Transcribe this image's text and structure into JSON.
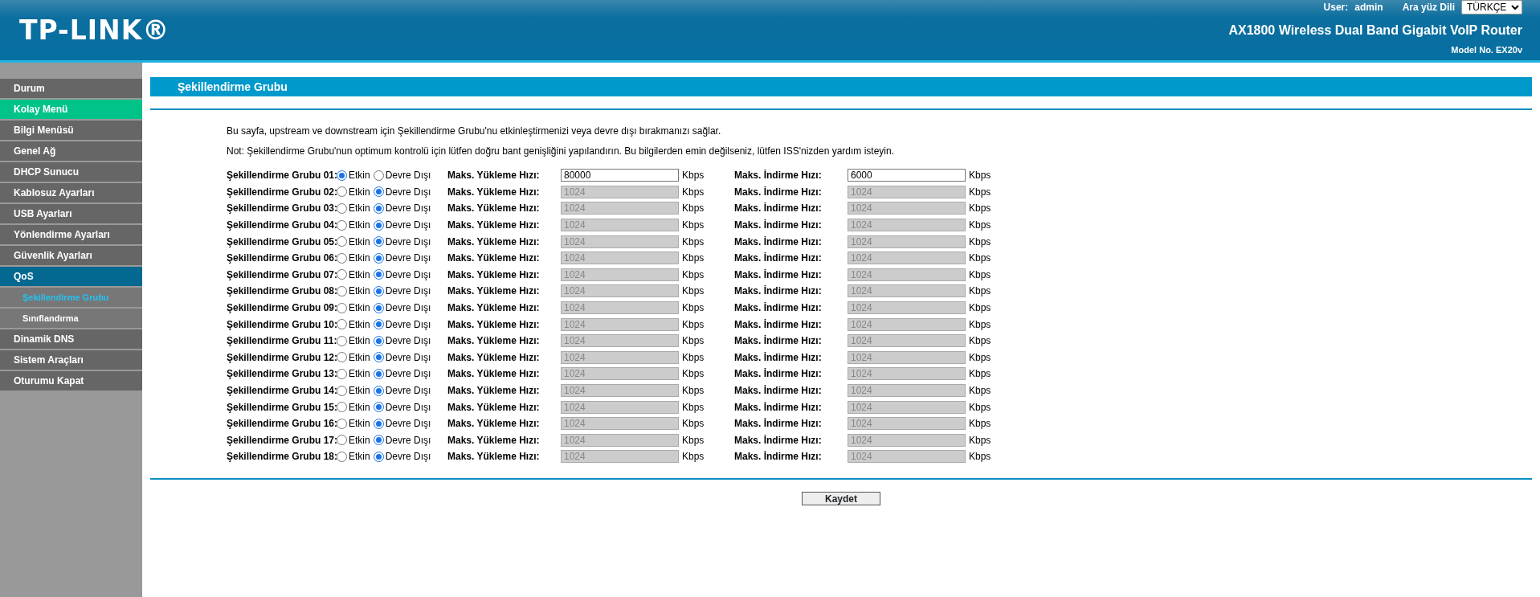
{
  "header": {
    "logo": "TP-LINK®",
    "user_label": "User:",
    "user": "admin",
    "language_label": "Ara yüz Dili",
    "language": "TÜRKÇE",
    "product": "AX1800 Wireless Dual Band Gigabit VoIP Router",
    "model": "Model No. EX20v"
  },
  "sidebar": {
    "items": [
      {
        "label": "Durum",
        "selected": false,
        "highlight": false
      },
      {
        "label": "Kolay Menü",
        "selected": false,
        "highlight": true
      },
      {
        "label": "Bilgi Menüsü",
        "selected": false,
        "highlight": false
      },
      {
        "label": "Genel Ağ",
        "selected": false,
        "highlight": false
      },
      {
        "label": "DHCP Sunucu",
        "selected": false,
        "highlight": false
      },
      {
        "label": "Kablosuz Ayarları",
        "selected": false,
        "highlight": false
      },
      {
        "label": "USB Ayarları",
        "selected": false,
        "highlight": false
      },
      {
        "label": "Yönlendirme Ayarları",
        "selected": false,
        "highlight": false
      },
      {
        "label": "Güvenlik Ayarları",
        "selected": false,
        "highlight": false
      },
      {
        "label": "QoS",
        "selected": true,
        "highlight": false,
        "children": [
          {
            "label": "Şekillendirme Grubu",
            "selected": true
          },
          {
            "label": "Sınıflandırma",
            "selected": false
          }
        ]
      },
      {
        "label": "Dinamik DNS",
        "selected": false,
        "highlight": false
      },
      {
        "label": "Sistem Araçları",
        "selected": false,
        "highlight": false
      },
      {
        "label": "Oturumu Kapat",
        "selected": false,
        "highlight": false
      }
    ]
  },
  "page": {
    "title": "Şekillendirme Grubu",
    "description": "Bu sayfa, upstream ve downstream için Şekillendirme Grubu'nu etkinleştirmenizi veya devre dışı bırakmanızı sağlar.",
    "note": "Not: Şekillendirme Grubu'nun optimum kontrolü için lütfen doğru bant genişliğini yapılandırın. Bu bilgilerden emin değilseniz, lütfen ISS'nizden yardım isteyin.",
    "rows": [
      {
        "label": "Şekillendirme Grubu 01:",
        "options": [
          {
            "label": "Etkin",
            "selected": true
          },
          {
            "label": "Devre Dışı",
            "selected": false
          }
        ],
        "upload": {
          "label": "Maks. Yükleme Hızı:",
          "value": "80000",
          "unit": "Kbps",
          "disabled": false
        },
        "download": {
          "label": "Maks. İndirme Hızı:",
          "value": "6000",
          "unit": "Kbps",
          "disabled": false
        }
      },
      {
        "label": "Şekillendirme Grubu 02:",
        "options": [
          {
            "label": "Etkin",
            "selected": false
          },
          {
            "label": "Devre Dışı",
            "selected": true
          }
        ],
        "upload": {
          "label": "Maks. Yükleme Hızı:",
          "value": "1024",
          "unit": "Kbps",
          "disabled": true
        },
        "download": {
          "label": "Maks. İndirme Hızı:",
          "value": "1024",
          "unit": "Kbps",
          "disabled": true
        }
      },
      {
        "label": "Şekillendirme Grubu 03:",
        "options": [
          {
            "label": "Etkin",
            "selected": false
          },
          {
            "label": "Devre Dışı",
            "selected": true
          }
        ],
        "upload": {
          "label": "Maks. Yükleme Hızı:",
          "value": "1024",
          "unit": "Kbps",
          "disabled": true
        },
        "download": {
          "label": "Maks. İndirme Hızı:",
          "value": "1024",
          "unit": "Kbps",
          "disabled": true
        }
      },
      {
        "label": "Şekillendirme Grubu 04:",
        "options": [
          {
            "label": "Etkin",
            "selected": false
          },
          {
            "label": "Devre Dışı",
            "selected": true
          }
        ],
        "upload": {
          "label": "Maks. Yükleme Hızı:",
          "value": "1024",
          "unit": "Kbps",
          "disabled": true
        },
        "download": {
          "label": "Maks. İndirme Hızı:",
          "value": "1024",
          "unit": "Kbps",
          "disabled": true
        }
      },
      {
        "label": "Şekillendirme Grubu 05:",
        "options": [
          {
            "label": "Etkin",
            "selected": false
          },
          {
            "label": "Devre Dışı",
            "selected": true
          }
        ],
        "upload": {
          "label": "Maks. Yükleme Hızı:",
          "value": "1024",
          "unit": "Kbps",
          "disabled": true
        },
        "download": {
          "label": "Maks. İndirme Hızı:",
          "value": "1024",
          "unit": "Kbps",
          "disabled": true
        }
      },
      {
        "label": "Şekillendirme Grubu 06:",
        "options": [
          {
            "label": "Etkin",
            "selected": false
          },
          {
            "label": "Devre Dışı",
            "selected": true
          }
        ],
        "upload": {
          "label": "Maks. Yükleme Hızı:",
          "value": "1024",
          "unit": "Kbps",
          "disabled": true
        },
        "download": {
          "label": "Maks. İndirme Hızı:",
          "value": "1024",
          "unit": "Kbps",
          "disabled": true
        }
      },
      {
        "label": "Şekillendirme Grubu 07:",
        "options": [
          {
            "label": "Etkin",
            "selected": false
          },
          {
            "label": "Devre Dışı",
            "selected": true
          }
        ],
        "upload": {
          "label": "Maks. Yükleme Hızı:",
          "value": "1024",
          "unit": "Kbps",
          "disabled": true
        },
        "download": {
          "label": "Maks. İndirme Hızı:",
          "value": "1024",
          "unit": "Kbps",
          "disabled": true
        }
      },
      {
        "label": "Şekillendirme Grubu 08:",
        "options": [
          {
            "label": "Etkin",
            "selected": false
          },
          {
            "label": "Devre Dışı",
            "selected": true
          }
        ],
        "upload": {
          "label": "Maks. Yükleme Hızı:",
          "value": "1024",
          "unit": "Kbps",
          "disabled": true
        },
        "download": {
          "label": "Maks. İndirme Hızı:",
          "value": "1024",
          "unit": "Kbps",
          "disabled": true
        }
      },
      {
        "label": "Şekillendirme Grubu 09:",
        "options": [
          {
            "label": "Etkin",
            "selected": false
          },
          {
            "label": "Devre Dışı",
            "selected": true
          }
        ],
        "upload": {
          "label": "Maks. Yükleme Hızı:",
          "value": "1024",
          "unit": "Kbps",
          "disabled": true
        },
        "download": {
          "label": "Maks. İndirme Hızı:",
          "value": "1024",
          "unit": "Kbps",
          "disabled": true
        }
      },
      {
        "label": "Şekillendirme Grubu 10:",
        "options": [
          {
            "label": "Etkin",
            "selected": false
          },
          {
            "label": "Devre Dışı",
            "selected": true
          }
        ],
        "upload": {
          "label": "Maks. Yükleme Hızı:",
          "value": "1024",
          "unit": "Kbps",
          "disabled": true
        },
        "download": {
          "label": "Maks. İndirme Hızı:",
          "value": "1024",
          "unit": "Kbps",
          "disabled": true
        }
      },
      {
        "label": "Şekillendirme Grubu 11:",
        "options": [
          {
            "label": "Etkin",
            "selected": false
          },
          {
            "label": "Devre Dışı",
            "selected": true
          }
        ],
        "upload": {
          "label": "Maks. Yükleme Hızı:",
          "value": "1024",
          "unit": "Kbps",
          "disabled": true
        },
        "download": {
          "label": "Maks. İndirme Hızı:",
          "value": "1024",
          "unit": "Kbps",
          "disabled": true
        }
      },
      {
        "label": "Şekillendirme Grubu 12:",
        "options": [
          {
            "label": "Etkin",
            "selected": false
          },
          {
            "label": "Devre Dışı",
            "selected": true
          }
        ],
        "upload": {
          "label": "Maks. Yükleme Hızı:",
          "value": "1024",
          "unit": "Kbps",
          "disabled": true
        },
        "download": {
          "label": "Maks. İndirme Hızı:",
          "value": "1024",
          "unit": "Kbps",
          "disabled": true
        }
      },
      {
        "label": "Şekillendirme Grubu 13:",
        "options": [
          {
            "label": "Etkin",
            "selected": false
          },
          {
            "label": "Devre Dışı",
            "selected": true
          }
        ],
        "upload": {
          "label": "Maks. Yükleme Hızı:",
          "value": "1024",
          "unit": "Kbps",
          "disabled": true
        },
        "download": {
          "label": "Maks. İndirme Hızı:",
          "value": "1024",
          "unit": "Kbps",
          "disabled": true
        }
      },
      {
        "label": "Şekillendirme Grubu 14:",
        "options": [
          {
            "label": "Etkin",
            "selected": false
          },
          {
            "label": "Devre Dışı",
            "selected": true
          }
        ],
        "upload": {
          "label": "Maks. Yükleme Hızı:",
          "value": "1024",
          "unit": "Kbps",
          "disabled": true
        },
        "download": {
          "label": "Maks. İndirme Hızı:",
          "value": "1024",
          "unit": "Kbps",
          "disabled": true
        }
      },
      {
        "label": "Şekillendirme Grubu 15:",
        "options": [
          {
            "label": "Etkin",
            "selected": false
          },
          {
            "label": "Devre Dışı",
            "selected": true
          }
        ],
        "upload": {
          "label": "Maks. Yükleme Hızı:",
          "value": "1024",
          "unit": "Kbps",
          "disabled": true
        },
        "download": {
          "label": "Maks. İndirme Hızı:",
          "value": "1024",
          "unit": "Kbps",
          "disabled": true
        }
      },
      {
        "label": "Şekillendirme Grubu 16:",
        "options": [
          {
            "label": "Etkin",
            "selected": false
          },
          {
            "label": "Devre Dışı",
            "selected": true
          }
        ],
        "upload": {
          "label": "Maks. Yükleme Hızı:",
          "value": "1024",
          "unit": "Kbps",
          "disabled": true
        },
        "download": {
          "label": "Maks. İndirme Hızı:",
          "value": "1024",
          "unit": "Kbps",
          "disabled": true
        }
      },
      {
        "label": "Şekillendirme Grubu 17:",
        "options": [
          {
            "label": "Etkin",
            "selected": false
          },
          {
            "label": "Devre Dışı",
            "selected": true
          }
        ],
        "upload": {
          "label": "Maks. Yükleme Hızı:",
          "value": "1024",
          "unit": "Kbps",
          "disabled": true
        },
        "download": {
          "label": "Maks. İndirme Hızı:",
          "value": "1024",
          "unit": "Kbps",
          "disabled": true
        }
      },
      {
        "label": "Şekillendirme Grubu 18:",
        "options": [
          {
            "label": "Etkin",
            "selected": false
          },
          {
            "label": "Devre Dışı",
            "selected": true
          }
        ],
        "upload": {
          "label": "Maks. Yükleme Hızı:",
          "value": "1024",
          "unit": "Kbps",
          "disabled": true
        },
        "download": {
          "label": "Maks. İndirme Hızı:",
          "value": "1024",
          "unit": "Kbps",
          "disabled": true
        }
      }
    ],
    "save_button": "Kaydet"
  }
}
